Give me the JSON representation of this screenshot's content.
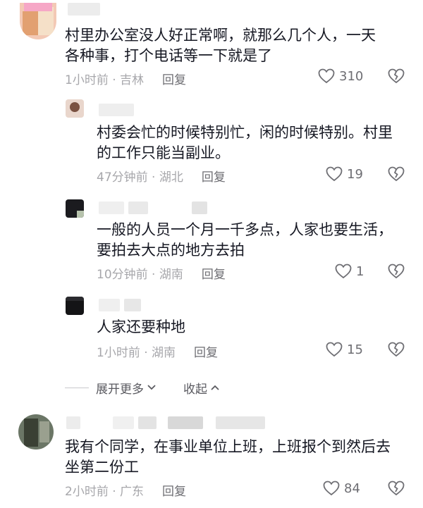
{
  "comments": [
    {
      "text": "村里办公室没人好正常啊，就那么几个人，一天各种事，打个电话等一下就是了",
      "time": "1小时前 · 吉林",
      "reply": "回复",
      "likes": "310"
    },
    {
      "text": "村委会忙的时候特别忙，闲的时候特别。村里的工作只能当副业。",
      "time": "47分钟前 · 湖北",
      "reply": "回复",
      "likes": "19"
    },
    {
      "text": "一般的人员一个月一千多点，人家也要生活，要拍去大点的地方去拍",
      "time": "10分钟前 · 湖南",
      "reply": "回复",
      "likes": "1"
    },
    {
      "text": "人家还要种地",
      "time": "1小时前 · 湖南",
      "reply": "回复",
      "likes": "15"
    },
    {
      "text": "我有个同学，在事业单位上班，上班报个到然后去坐第二份工",
      "time": "2小时前 · 广东",
      "reply": "回复",
      "likes": "84"
    }
  ],
  "expand": {
    "more": "展开更多",
    "collapse": "收起"
  },
  "icons": {
    "like": "heart-outline-icon",
    "dislike": "broken-heart-icon"
  },
  "colors": {
    "text": "#161823",
    "meta": "#a7a7ab",
    "icon": "#6e6e73"
  }
}
